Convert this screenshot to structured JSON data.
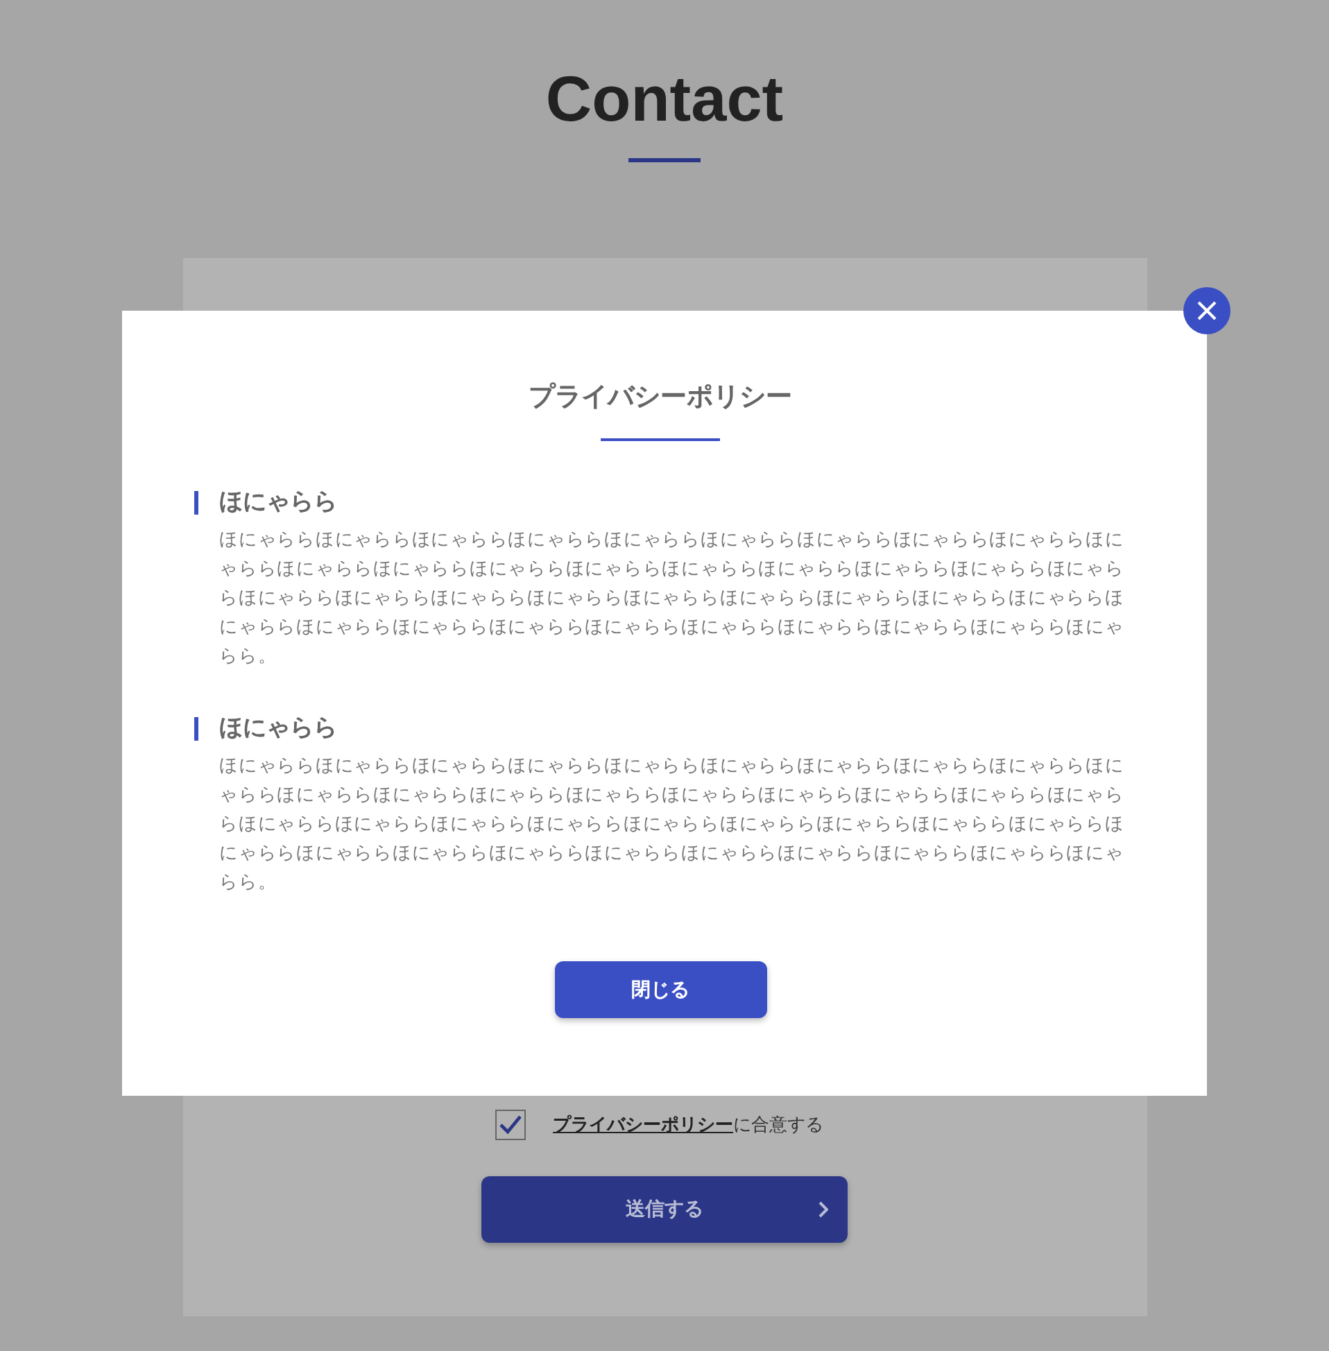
{
  "page": {
    "title": "Contact"
  },
  "form": {
    "agree": {
      "checked": true,
      "link": "プライバシーポリシー",
      "text": "に合意する"
    },
    "submit": {
      "label": "送信する"
    }
  },
  "modal": {
    "title": "プライバシーポリシー",
    "sections": [
      {
        "heading": "ほにゃらら",
        "body": "ほにゃららほにゃららほにゃららほにゃららほにゃららほにゃららほにゃららほにゃららほにゃららほにゃららほにゃららほにゃららほにゃららほにゃららほにゃららほにゃららほにゃららほにゃららほにゃららほにゃららほにゃららほにゃららほにゃららほにゃららほにゃららほにゃららほにゃららほにゃららほにゃららほにゃららほにゃららほにゃららほにゃららほにゃららほにゃららほにゃららほにゃららほにゃらら。"
      },
      {
        "heading": "ほにゃらら",
        "body": "ほにゃららほにゃららほにゃららほにゃららほにゃららほにゃららほにゃららほにゃららほにゃららほにゃららほにゃららほにゃららほにゃららほにゃららほにゃららほにゃららほにゃららほにゃららほにゃららほにゃららほにゃららほにゃららほにゃららほにゃららほにゃららほにゃららほにゃららほにゃららほにゃららほにゃららほにゃららほにゃららほにゃららほにゃららほにゃららほにゃららほにゃららほにゃらら。"
      }
    ],
    "close_button": "閉じる"
  }
}
